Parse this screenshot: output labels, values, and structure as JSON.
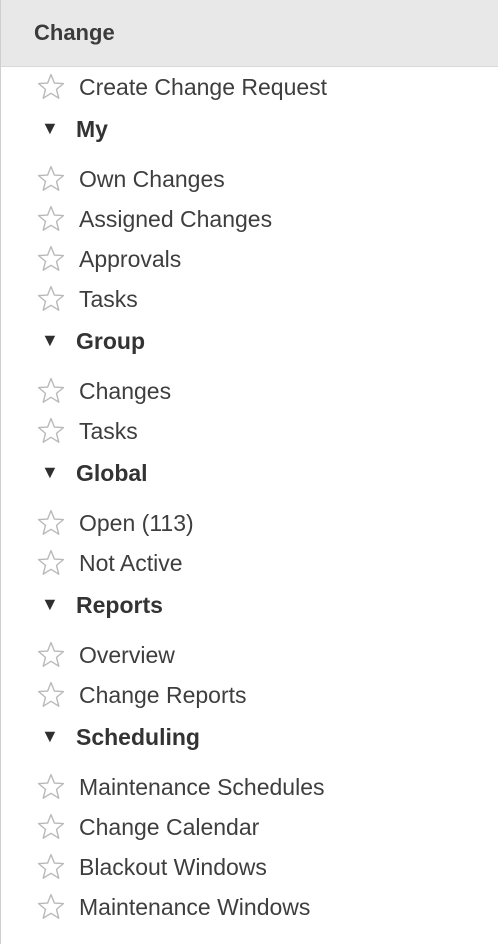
{
  "header": {
    "title": "Change"
  },
  "nav": {
    "top_items": [
      {
        "label": "Create Change Request",
        "icon": "star-outline-icon"
      }
    ],
    "groups": [
      {
        "label": "My",
        "icon": "caret-down-icon",
        "items": [
          {
            "label": "Own Changes",
            "icon": "star-outline-icon"
          },
          {
            "label": "Assigned Changes",
            "icon": "star-outline-icon"
          },
          {
            "label": "Approvals",
            "icon": "star-outline-icon"
          },
          {
            "label": "Tasks",
            "icon": "star-outline-icon"
          }
        ]
      },
      {
        "label": "Group",
        "icon": "caret-down-icon",
        "items": [
          {
            "label": "Changes",
            "icon": "star-outline-icon"
          },
          {
            "label": "Tasks",
            "icon": "star-outline-icon"
          }
        ]
      },
      {
        "label": "Global",
        "icon": "caret-down-icon",
        "items": [
          {
            "label": "Open (113)",
            "icon": "star-outline-icon"
          },
          {
            "label": "Not Active",
            "icon": "star-outline-icon"
          }
        ]
      },
      {
        "label": "Reports",
        "icon": "caret-down-icon",
        "items": [
          {
            "label": "Overview",
            "icon": "star-outline-icon"
          },
          {
            "label": "Change Reports",
            "icon": "star-outline-icon"
          }
        ]
      },
      {
        "label": "Scheduling",
        "icon": "caret-down-icon",
        "items": [
          {
            "label": "Maintenance Schedules",
            "icon": "star-outline-icon"
          },
          {
            "label": "Change Calendar",
            "icon": "star-outline-icon"
          },
          {
            "label": "Blackout Windows",
            "icon": "star-outline-icon"
          },
          {
            "label": "Maintenance Windows",
            "icon": "star-outline-icon"
          }
        ]
      }
    ]
  },
  "glyphs": {
    "caret_down": "▼"
  }
}
